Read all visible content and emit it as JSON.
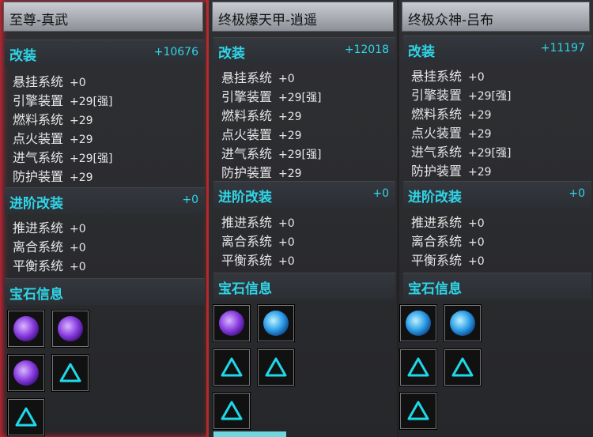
{
  "panels": [
    {
      "title": "至尊-真武",
      "mod_title": "改装",
      "mod_total": "+10676",
      "mods": [
        [
          "悬挂系统",
          "+0"
        ],
        [
          "引擎装置",
          "+29[强]"
        ],
        [
          "燃料系统",
          "+29"
        ],
        [
          "点火装置",
          "+29"
        ],
        [
          "进气系统",
          "+29[强]"
        ],
        [
          "防护装置",
          "+29"
        ]
      ],
      "adv_title": "进阶改装",
      "adv_total": "+0",
      "adv": [
        [
          "推进系统",
          "+0"
        ],
        [
          "离合系统",
          "+0"
        ],
        [
          "平衡系统",
          "+0"
        ]
      ],
      "gem_title": "宝石信息",
      "gems": [
        "purple",
        "purple",
        "purple",
        "empty",
        "empty"
      ]
    },
    {
      "title": "终极爆天甲-逍遥",
      "mod_title": "改装",
      "mod_total": "+12018",
      "mods": [
        [
          "悬挂系统",
          "+0"
        ],
        [
          "引擎装置",
          "+29[强]"
        ],
        [
          "燃料系统",
          "+29"
        ],
        [
          "点火装置",
          "+29"
        ],
        [
          "进气系统",
          "+29[强]"
        ],
        [
          "防护装置",
          "+29"
        ]
      ],
      "adv_title": "进阶改装",
      "adv_total": "+0",
      "adv": [
        [
          "推进系统",
          "+0"
        ],
        [
          "离合系统",
          "+0"
        ],
        [
          "平衡系统",
          "+0"
        ]
      ],
      "gem_title": "宝石信息",
      "gems": [
        "purple",
        "blue",
        "empty",
        "empty",
        "empty"
      ]
    },
    {
      "title": "终极众神-吕布",
      "mod_title": "改装",
      "mod_total": "+11197",
      "mods": [
        [
          "悬挂系统",
          "+0"
        ],
        [
          "引擎装置",
          "+29[强]"
        ],
        [
          "燃料系统",
          "+29"
        ],
        [
          "点火装置",
          "+29"
        ],
        [
          "进气系统",
          "+29[强]"
        ],
        [
          "防护装置",
          "+29"
        ]
      ],
      "adv_title": "进阶改装",
      "adv_total": "+0",
      "adv": [
        [
          "推进系统",
          "+0"
        ],
        [
          "离合系统",
          "+0"
        ],
        [
          "平衡系统",
          "+0"
        ]
      ],
      "gem_title": "宝石信息",
      "gems": [
        "blue",
        "blue",
        "empty",
        "empty",
        "empty"
      ]
    }
  ],
  "colors": {
    "accent": "#2fd6e8",
    "text": "#e6e6e6",
    "gem_purple": "#8a3fe0",
    "gem_blue": "#2e9fe8",
    "empty_slot": "#1fd8e8"
  },
  "icons": {
    "purple": "purple-gem-icon",
    "blue": "blue-gem-icon",
    "empty": "empty-triangle-slot-icon"
  }
}
